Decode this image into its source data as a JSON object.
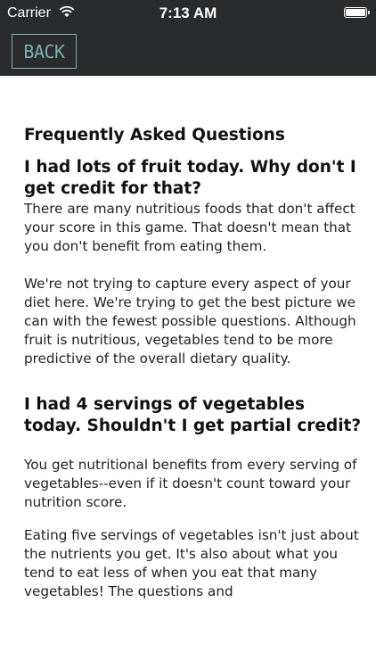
{
  "status_bar": {
    "carrier": "Carrier",
    "time": "7:13 AM",
    "wifi_icon": "wifi-icon",
    "battery_icon": "battery-icon"
  },
  "nav": {
    "back_label": "BACK",
    "accent_color": "#7fb0b4",
    "background_color": "#2a2b2d"
  },
  "faq": {
    "title": "Frequently Asked Questions",
    "items": [
      {
        "question": "I had lots of fruit today. Why don't I get credit for that?",
        "answers": [
          "There are many nutritious foods that don't affect your score in this game. That doesn't mean that you don't benefit from eating them.",
          "We're not trying to capture every aspect of your diet here. We're trying to get the best picture we can with the fewest possible questions. Although fruit is nutritious, vegetables tend to be more predictive of the overall dietary quality."
        ]
      },
      {
        "question": "I had 4 servings of vegetables today. Shouldn't I get partial credit?",
        "answers": [
          "You get nutritional benefits from every serving of vegetables--even if it doesn't count toward your nutrition score.",
          "Eating five servings of vegetables isn't just about the nutrients you get. It's also about what you tend to eat less of when you eat that many vegetables! The questions and"
        ]
      }
    ]
  }
}
